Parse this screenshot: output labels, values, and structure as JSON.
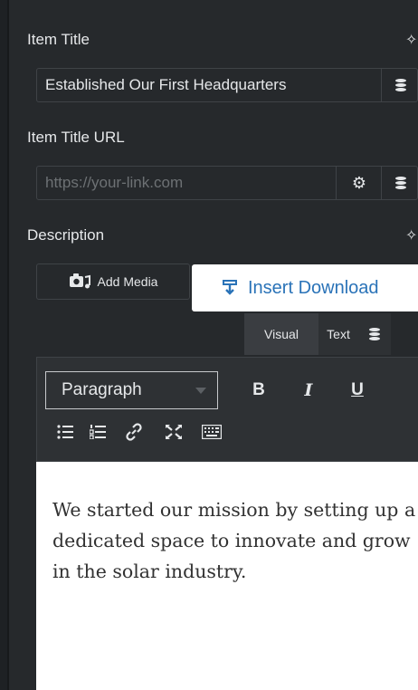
{
  "fields": {
    "item_title": {
      "label": "Item Title",
      "value": "Established Our First Headquarters"
    },
    "item_title_url": {
      "label": "Item Title URL",
      "placeholder": "https://your-link.com"
    },
    "description": {
      "label": "Description"
    }
  },
  "buttons": {
    "add_media": "Add Media",
    "insert_download": "Insert Download"
  },
  "editor_tabs": {
    "visual": "Visual",
    "text": "Text"
  },
  "toolbar": {
    "format_select": "Paragraph",
    "bold": "B",
    "italic": "I",
    "underline": "U"
  },
  "editor": {
    "content": "We started our mission by setting up a dedicated space to innovate and grow in the solar industry."
  },
  "colors": {
    "panel_bg": "#26292c",
    "insert_text": "#2a73b8",
    "editor_bg": "#ffffff"
  }
}
